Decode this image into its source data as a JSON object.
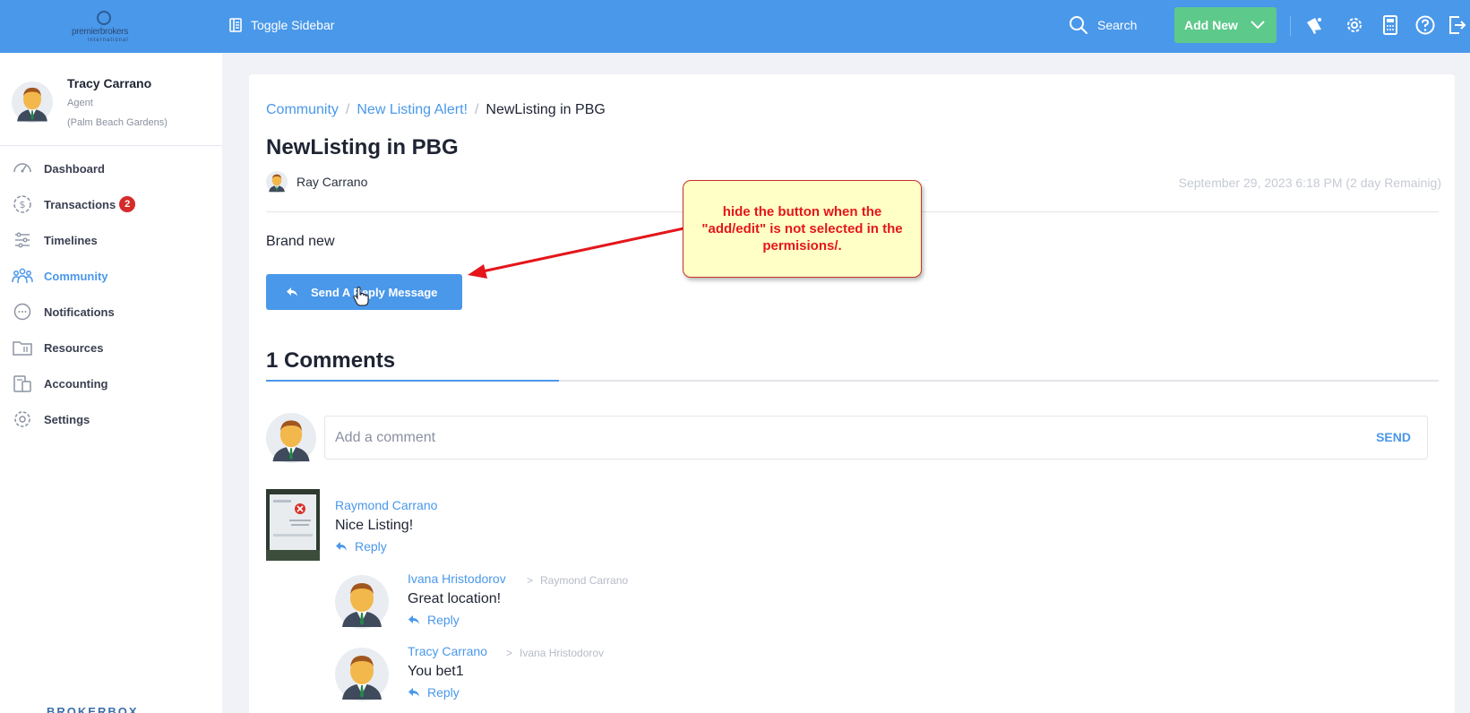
{
  "topbar": {
    "logo_text": "premierbrokers",
    "logo_sub": "international",
    "toggle_label": "Toggle Sidebar",
    "search_label": "Search",
    "add_new_label": "Add New",
    "icons": [
      "megaphone-icon",
      "gear-icon",
      "calculator-icon",
      "help-icon",
      "logout-icon"
    ]
  },
  "user": {
    "name": "Tracy Carrano",
    "role": "Agent",
    "location": "(Palm Beach Gardens)"
  },
  "sidebar": {
    "items": [
      {
        "label": "Dashboard",
        "icon": "gauge-icon",
        "active": false
      },
      {
        "label": "Transactions",
        "icon": "dollar-icon",
        "badge": "2",
        "active": false
      },
      {
        "label": "Timelines",
        "icon": "timeline-icon",
        "active": false
      },
      {
        "label": "Community",
        "icon": "people-icon",
        "active": true
      },
      {
        "label": "Notifications",
        "icon": "chat-icon",
        "active": false
      },
      {
        "label": "Resources",
        "icon": "folder-icon",
        "active": false
      },
      {
        "label": "Accounting",
        "icon": "clipboard-icon",
        "active": false
      },
      {
        "label": "Settings",
        "icon": "gear-icon",
        "active": false
      }
    ],
    "footer_brand": "BROKERBOX"
  },
  "breadcrumb": {
    "items": [
      "Community",
      "New Listing Alert!"
    ],
    "separator": "/",
    "current": "NewListing in PBG"
  },
  "post": {
    "title": "NewListing in PBG",
    "author": "Ray Carrano",
    "date": "September 29, 2023 6:18 PM (2 day Remainig)",
    "body": "Brand new",
    "reply_button_label": "Send A Reply Message"
  },
  "comments": {
    "title": "1 Comments",
    "input_placeholder": "Add a comment",
    "send_label": "SEND",
    "items": [
      {
        "author": "Raymond Carrano",
        "text": "Nice Listing!",
        "reply_label": "Reply"
      },
      {
        "author": "Ivana Hristodorov",
        "reply_to": "Raymond Carrano",
        "text": "Great location!",
        "reply_label": "Reply"
      },
      {
        "author": "Tracy Carrano",
        "reply_to": "Ivana Hristodorov",
        "text": "You bet1",
        "reply_label": "Reply"
      }
    ]
  },
  "annotation": {
    "text": "hide the button when the \"add/edit\" is not selected in the permisions/."
  },
  "colors": {
    "accent": "#4a98ea",
    "add_new": "#5dc98b",
    "badge": "#d52b2b",
    "callout_bg": "#ffffc6",
    "callout_text": "#e4161b"
  }
}
